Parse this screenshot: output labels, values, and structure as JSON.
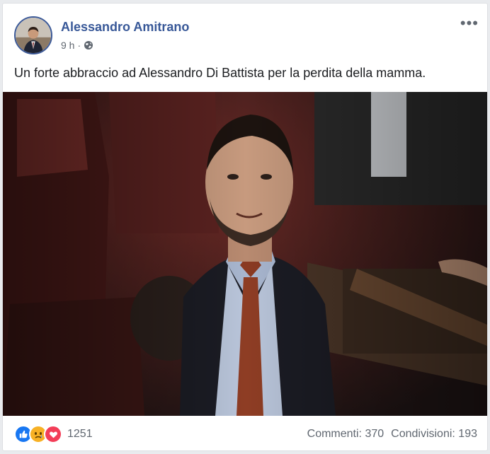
{
  "post": {
    "author": "Alessandro Amitrano",
    "time": "9 h",
    "separator": "·",
    "audience_icon": "globe-icon",
    "more_icon": "more-options-icon",
    "more_label": "•••",
    "text": "Un forte abbraccio ad Alessandro Di Battista per la perdita della mamma."
  },
  "footer": {
    "reactions": [
      "like-icon",
      "sad-icon",
      "love-icon"
    ],
    "reaction_count": "1251",
    "comments": "Commenti: 370",
    "shares": "Condivisioni: 193"
  },
  "colors": {
    "author": "#385898",
    "like": "#1877f2",
    "sad": "#f7b125",
    "love": "#f33e58"
  }
}
